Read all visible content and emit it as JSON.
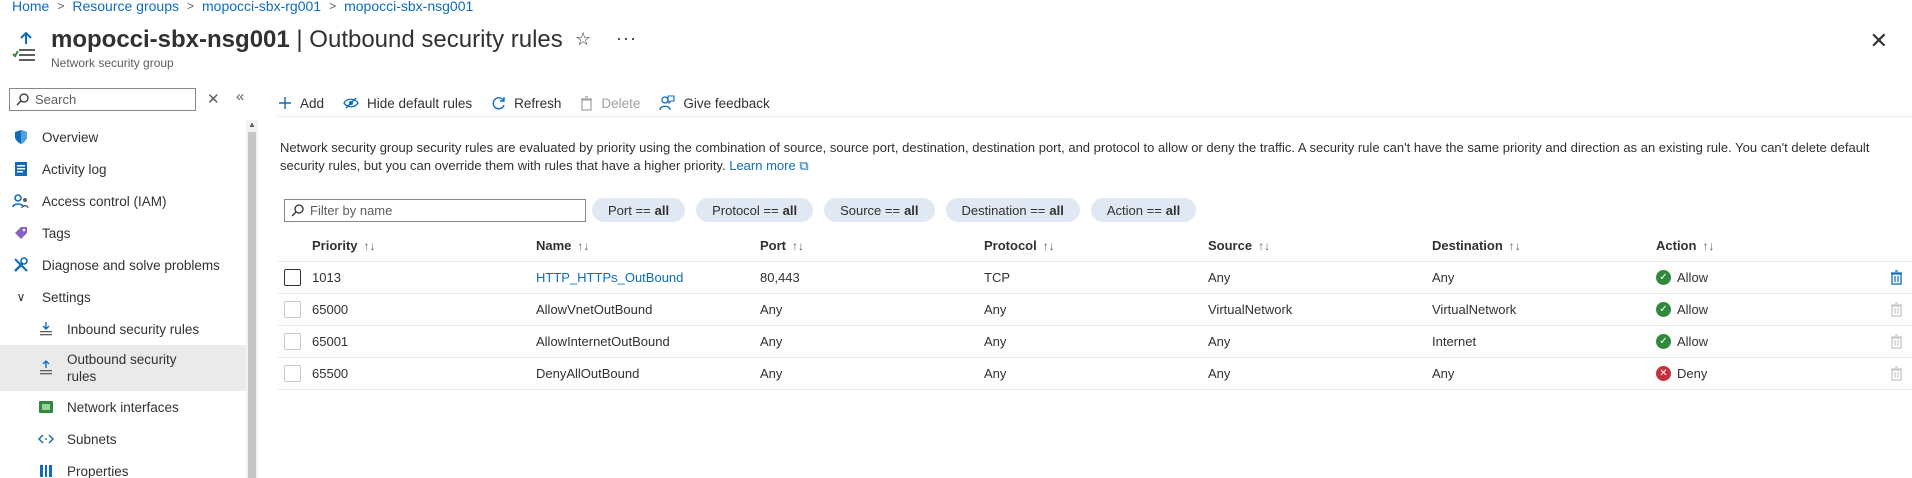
{
  "breadcrumb": [
    "Home",
    "Resource groups",
    "mopocci-sbx-rg001",
    "mopocci-sbx-nsg001"
  ],
  "header": {
    "resource_name": "mopocci-sbx-nsg001",
    "page_title": " | Outbound security rules",
    "subtitle": "Network security group"
  },
  "sidebar": {
    "search_placeholder": "Search",
    "items": [
      {
        "label": "Overview",
        "icon": "shield-icon"
      },
      {
        "label": "Activity log",
        "icon": "log-icon"
      },
      {
        "label": "Access control (IAM)",
        "icon": "people-icon"
      },
      {
        "label": "Tags",
        "icon": "tag-icon"
      },
      {
        "label": "Diagnose and solve problems",
        "icon": "wrench-icon"
      },
      {
        "label": "Settings",
        "icon": "chevron-down-icon"
      },
      {
        "label": "Inbound security rules",
        "icon": "inbound-icon"
      },
      {
        "label": "Outbound security rules",
        "icon": "outbound-icon"
      },
      {
        "label": "Network interfaces",
        "icon": "nic-icon"
      },
      {
        "label": "Subnets",
        "icon": "subnet-icon"
      },
      {
        "label": "Properties",
        "icon": "properties-icon"
      }
    ]
  },
  "toolbar": {
    "add": "Add",
    "hide_default": "Hide default rules",
    "refresh": "Refresh",
    "delete": "Delete",
    "feedback": "Give feedback"
  },
  "description": {
    "text": "Network security group security rules are evaluated by priority using the combination of source, source port, destination, destination port, and protocol to allow or deny the traffic. A security rule can't have the same priority and direction as an existing rule. You can't delete default security rules, but you can override them with rules that have a higher priority.",
    "link": "Learn more"
  },
  "filters": {
    "placeholder": "Filter by name",
    "pills": [
      {
        "label": "Port ==",
        "value": "all"
      },
      {
        "label": "Protocol ==",
        "value": "all"
      },
      {
        "label": "Source ==",
        "value": "all"
      },
      {
        "label": "Destination ==",
        "value": "all"
      },
      {
        "label": "Action ==",
        "value": "all"
      }
    ]
  },
  "table": {
    "columns": [
      "Priority",
      "Name",
      "Port",
      "Protocol",
      "Source",
      "Destination",
      "Action"
    ],
    "rows": [
      {
        "priority": "1013",
        "name": "HTTP_HTTPs_OutBound",
        "port": "80,443",
        "protocol": "TCP",
        "source": "Any",
        "destination": "Any",
        "action": "Allow"
      },
      {
        "priority": "65000",
        "name": "AllowVnetOutBound",
        "port": "Any",
        "protocol": "Any",
        "source": "VirtualNetwork",
        "destination": "VirtualNetwork",
        "action": "Allow"
      },
      {
        "priority": "65001",
        "name": "AllowInternetOutBound",
        "port": "Any",
        "protocol": "Any",
        "source": "Any",
        "destination": "Internet",
        "action": "Allow"
      },
      {
        "priority": "65500",
        "name": "DenyAllOutBound",
        "port": "Any",
        "protocol": "Any",
        "source": "Any",
        "destination": "Any",
        "action": "Deny"
      }
    ]
  },
  "colors": {
    "accent": "#0f6cbd",
    "allow": "#2f8a3e",
    "deny": "#c5303e",
    "pill": "#dfe8f3"
  }
}
